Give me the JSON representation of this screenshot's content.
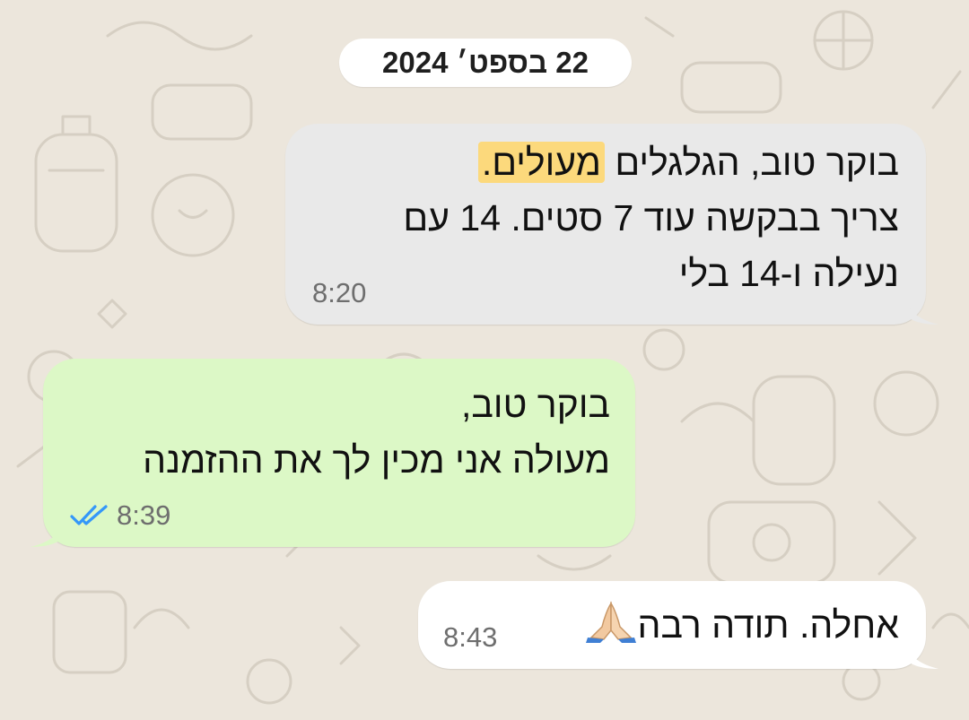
{
  "chat": {
    "date_separator": "22 בספט׳ 2024",
    "messages": [
      {
        "direction": "incoming",
        "lines": [
          "בוקר טוב,  הגלגלים",
          "מעולים.",
          "צריך בבקשה עוד 7 סטים. 14 עם",
          "נעילה ו-14 בלי"
        ],
        "time": "8:20"
      },
      {
        "direction": "outgoing",
        "lines": [
          "בוקר טוב,",
          "מעולה אני מכין לך את ההזמנה"
        ],
        "time": "8:39",
        "status_icon": "double-check-read-icon"
      },
      {
        "direction": "incoming",
        "text": "אחלה. תודה רבה",
        "emoji": "folded-hands-icon",
        "time": "8:43"
      }
    ]
  },
  "colors": {
    "background": "#ece6dc",
    "incoming_bubble": "#e9e9e9",
    "outgoing_bubble": "#dcf8c6",
    "highlight": "#fcd97c",
    "read_ticks": "#3497f9"
  }
}
